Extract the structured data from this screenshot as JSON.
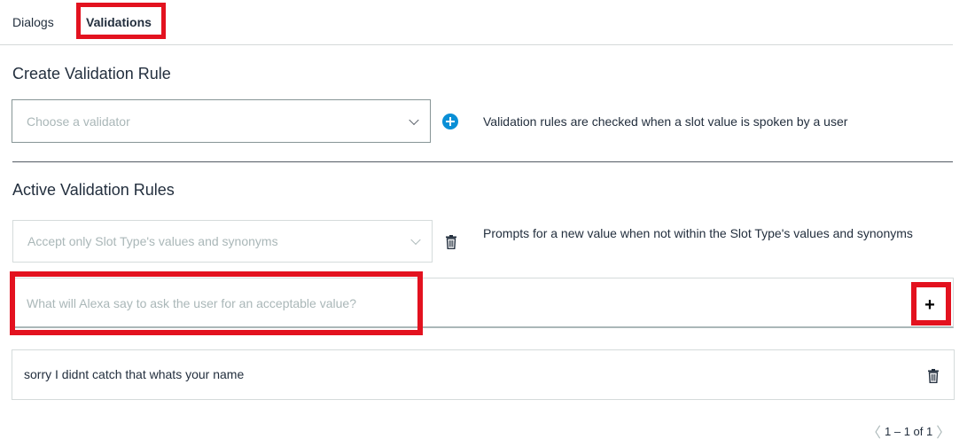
{
  "tabs": {
    "dialogs": "Dialogs",
    "validations": "Validations"
  },
  "create": {
    "heading": "Create Validation Rule",
    "select_placeholder": "Choose a validator",
    "help": "Validation rules are checked when a slot value is spoken by a user"
  },
  "active": {
    "heading": "Active Validation Rules",
    "rule_value": "Accept only Slot Type's values and synonyms",
    "rule_help": "Prompts for a new value when not within the Slot Type's values and synonyms",
    "prompt_placeholder": "What will Alexa say to ask the user for an acceptable value?",
    "add_label": "+",
    "prompts": [
      "sorry I didnt catch that whats your name"
    ]
  },
  "pagination": {
    "prev": "〈",
    "label": "1 – 1 of 1",
    "next": "〉"
  },
  "colors": {
    "highlight": "#e3121f",
    "accent": "#0a8fd6",
    "text": "#232f3e"
  },
  "icons": {
    "add_circle": "plus-circle-icon",
    "delete": "trash-icon",
    "dropdown": "chevron-down-icon"
  }
}
